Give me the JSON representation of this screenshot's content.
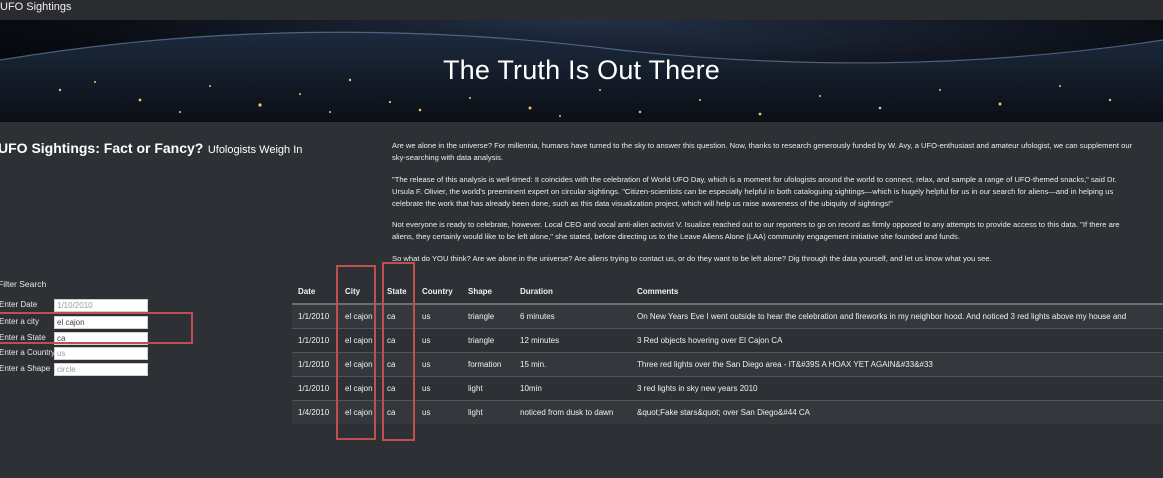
{
  "navbar": {
    "brand": "UFO Sightings"
  },
  "hero": {
    "title": "The Truth Is Out There"
  },
  "sidebar": {
    "heading_main": "UFO Sightings: Fact or Fancy?",
    "heading_sub": "Ufologists Weigh In",
    "filter_title": "Filter Search",
    "filters": [
      {
        "label": "Enter Date",
        "value": "",
        "placeholder": "1/10/2010"
      },
      {
        "label": "Enter a city",
        "value": "el cajon",
        "placeholder": ""
      },
      {
        "label": "Enter a State",
        "value": "ca",
        "placeholder": ""
      },
      {
        "label": "Enter a Country",
        "value": "",
        "placeholder": "us"
      },
      {
        "label": "Enter a Shape",
        "value": "",
        "placeholder": "circle"
      }
    ]
  },
  "article": {
    "p1_l1": "Are we alone in the universe? For millennia, humans have turned to the sky to answer this question. Now, thanks to research generously funded by W. Avy, a UFO-enthusiast and amateur ufologist, we can supplement our",
    "p1_l2": "sky-searching with data analysis.",
    "p2_l1": "\"The release of this analysis is well-timed: It coincides with the celebration of World UFO Day, which is a moment for ufologists around the world to connect, relax, and sample a range of UFO-themed snacks,\" said Dr.",
    "p2_l2": "Ursula F. Olivier, the world's preeminent expert on circular sightings. \"Citizen-scientists can be especially helpful in both cataloguing sightings—which is hugely helpful for us in our search for aliens—and in helping us",
    "p2_l3": "celebrate the work that has already been done, such as this data visualization project, which will help us raise awareness of the ubiquity of sightings!\"",
    "p3_l1": "Not everyone is ready to celebrate, however. Local CEO and vocal anti-alien activist V. Isualize reached out to our reporters to go on record as firmly opposed to any attempts to provide access to this data. \"If there are",
    "p3_l2": "aliens, they certainly would like to be left alone,\" she stated, before directing us to the Leave Aliens Alone (LAA) community engagement initiative she founded and funds.",
    "p4_l1": "So what do YOU think? Are we alone in the universe? Are aliens trying to contact us, or do they want to be left alone? Dig through the data yourself, and let us know what you see."
  },
  "table": {
    "headers": [
      "Date",
      "City",
      "State",
      "Country",
      "Shape",
      "Duration",
      "Comments"
    ],
    "rows": [
      [
        "1/1/2010",
        "el cajon",
        "ca",
        "us",
        "triangle",
        "6 minutes",
        "On New Years Eve I went outside to hear the celebration and fireworks in my neighbor hood. And noticed 3 red lights above my house and"
      ],
      [
        "1/1/2010",
        "el cajon",
        "ca",
        "us",
        "triangle",
        "12 minutes",
        "3 Red objects hovering over El Cajon CA"
      ],
      [
        "1/1/2010",
        "el cajon",
        "ca",
        "us",
        "formation",
        "15 min.",
        "Three red lights over the San Diego area - IT&#39S A HOAX YET AGAIN&#33&#33"
      ],
      [
        "1/1/2010",
        "el cajon",
        "ca",
        "us",
        "light",
        "10min",
        "3 red lights in sky new years 2010"
      ],
      [
        "1/4/2010",
        "el cajon",
        "ca",
        "us",
        "light",
        "noticed from dusk to dawn",
        "&quot;Fake stars&quot; over San Diego&#44 CA"
      ]
    ]
  },
  "colors": {
    "background": "#2d3035",
    "annotation": "#c0504d"
  }
}
